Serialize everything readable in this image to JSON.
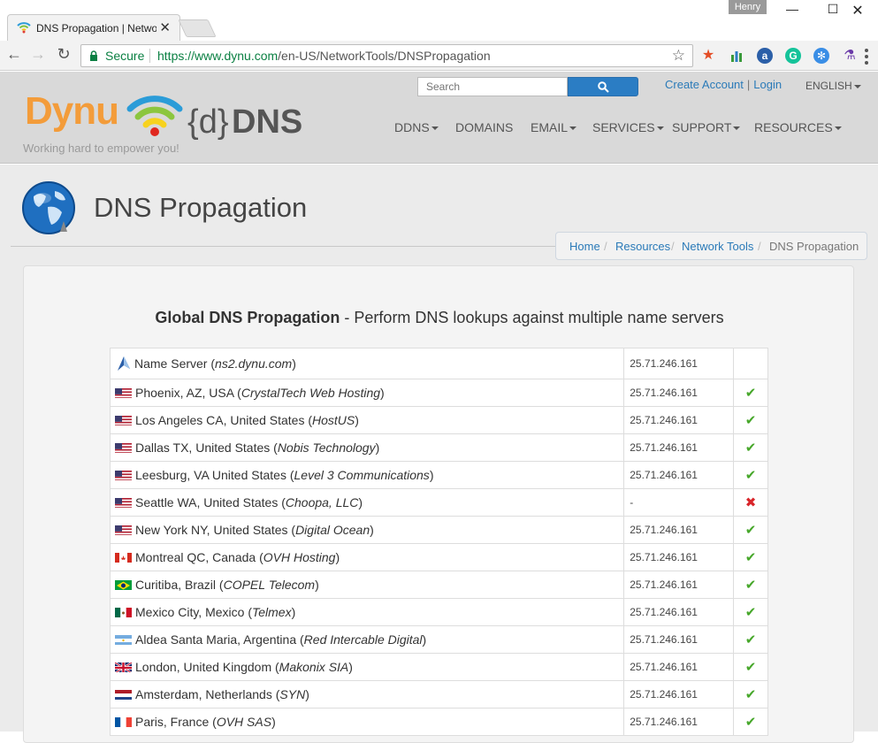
{
  "browser": {
    "tab_title": "DNS Propagation | Network Tools",
    "profile_name": "Henry",
    "secure_label": "Secure",
    "url_host": "https://www.dynu.com",
    "url_path": "/en-US/NetworkTools/DNSPropagation"
  },
  "header": {
    "logo_text": "Dynu",
    "logo_d": "{d}",
    "logo_dns": "DNS",
    "tagline": "Working hard to empower you!",
    "search_placeholder": "Search",
    "create_account": "Create Account",
    "separator": "|",
    "login": "Login",
    "language": "ENGLISH",
    "nav": [
      "DDNS",
      "DOMAINS",
      "EMAIL",
      "SERVICES",
      "SUPPORT",
      "RESOURCES"
    ]
  },
  "page": {
    "title": "DNS Propagation",
    "breadcrumb": [
      "Home",
      "Resources",
      "Network Tools",
      "DNS Propagation"
    ],
    "heading_bold": "Global DNS Propagation",
    "heading_rest": " - Perform DNS lookups against multiple name servers"
  },
  "results": {
    "name_server": {
      "label": "Name Server (",
      "provider": "ns2.dynu.com",
      "close": ")",
      "ip": "25.71.246.161"
    },
    "rows": [
      {
        "flag": "us",
        "location": "Phoenix, AZ, USA (",
        "provider": "CrystalTech Web Hosting",
        "ip": "25.71.246.161",
        "status": "ok"
      },
      {
        "flag": "us",
        "location": "Los Angeles CA, United States (",
        "provider": "HostUS",
        "ip": "25.71.246.161",
        "status": "ok"
      },
      {
        "flag": "us",
        "location": "Dallas TX, United States (",
        "provider": "Nobis Technology",
        "ip": "25.71.246.161",
        "status": "ok"
      },
      {
        "flag": "us",
        "location": "Leesburg, VA United States (",
        "provider": "Level 3 Communications",
        "ip": "25.71.246.161",
        "status": "ok"
      },
      {
        "flag": "us",
        "location": "Seattle WA, United States (",
        "provider": "Choopa, LLC",
        "ip": "-",
        "status": "fail"
      },
      {
        "flag": "us",
        "location": "New York NY, United States (",
        "provider": "Digital Ocean",
        "ip": "25.71.246.161",
        "status": "ok"
      },
      {
        "flag": "ca",
        "location": "Montreal QC, Canada (",
        "provider": "OVH Hosting",
        "ip": "25.71.246.161",
        "status": "ok"
      },
      {
        "flag": "br",
        "location": "Curitiba, Brazil (",
        "provider": "COPEL Telecom",
        "ip": "25.71.246.161",
        "status": "ok"
      },
      {
        "flag": "mx",
        "location": "Mexico City, Mexico (",
        "provider": "Telmex",
        "ip": "25.71.246.161",
        "status": "ok"
      },
      {
        "flag": "ar",
        "location": "Aldea Santa Maria, Argentina (",
        "provider": "Red Intercable Digital",
        "ip": "25.71.246.161",
        "status": "ok"
      },
      {
        "flag": "gb",
        "location": "London, United Kingdom (",
        "provider": "Makonix SIA",
        "ip": "25.71.246.161",
        "status": "ok"
      },
      {
        "flag": "nl",
        "location": "Amsterdam, Netherlands (",
        "provider": "SYN",
        "ip": "25.71.246.161",
        "status": "ok"
      },
      {
        "flag": "fr",
        "location": "Paris, France (",
        "provider": "OVH SAS",
        "ip": "25.71.246.161",
        "status": "ok"
      }
    ]
  },
  "colors": {
    "ok": "#46a72a",
    "fail": "#d9262b",
    "link": "#2a7ab8",
    "search_button": "#2b7dc4",
    "logo_orange": "#f39c3a"
  }
}
